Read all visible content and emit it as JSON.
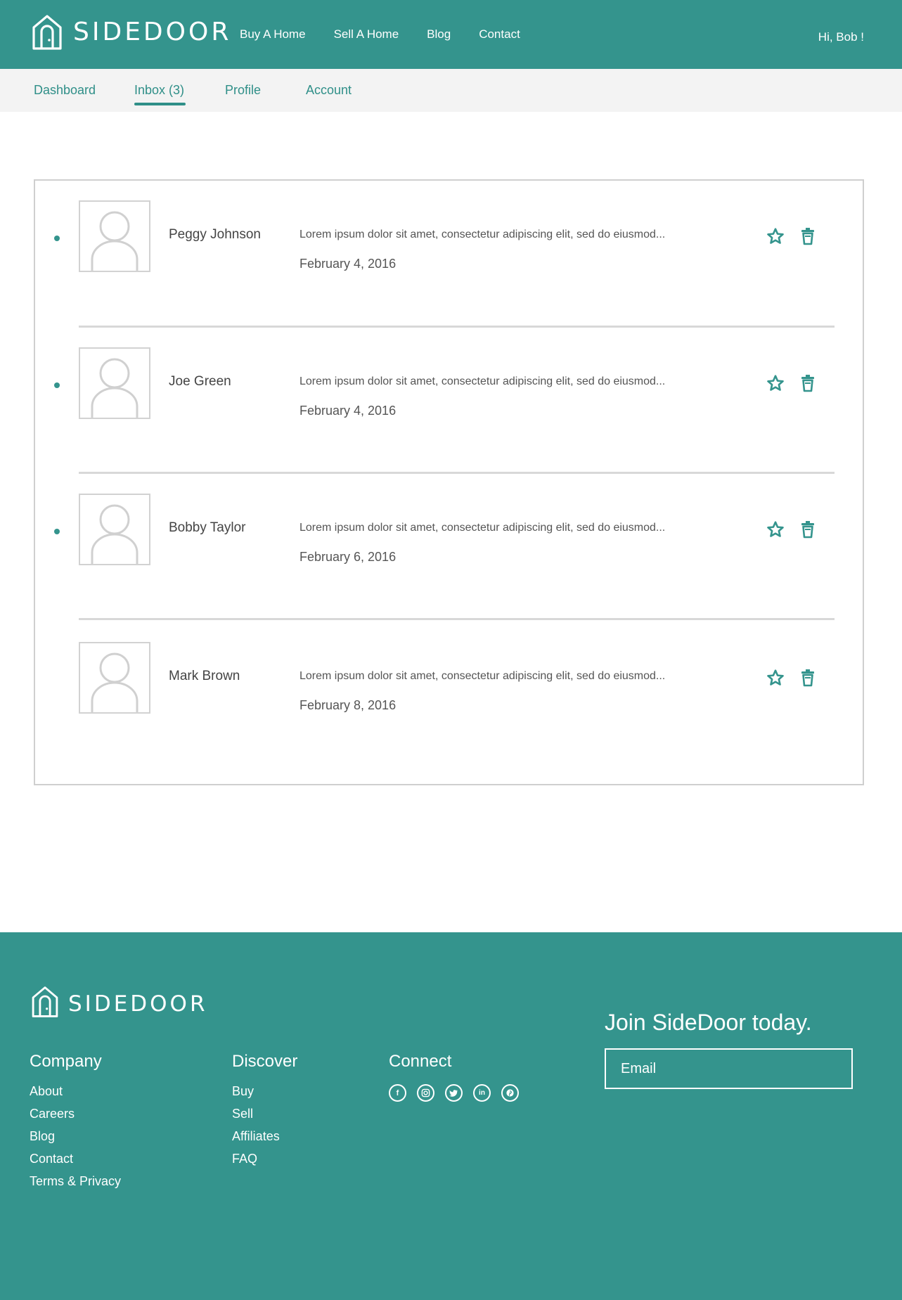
{
  "brand": {
    "name": "SIDEDOOR",
    "primary_color": "#34948d"
  },
  "header": {
    "nav": [
      "Buy A Home",
      "Sell A Home",
      "Blog",
      "Contact"
    ],
    "greeting": "Hi, Bob !"
  },
  "subnav": {
    "tabs": [
      "Dashboard",
      "Inbox (3)",
      "Profile",
      "Account"
    ],
    "active_tab": "Inbox (3)"
  },
  "inbox": {
    "messages": [
      {
        "sender": "Peggy Johnson",
        "preview": "Lorem ipsum dolor sit amet, consectetur adipiscing elit, sed do eiusmod...",
        "date": "February 4, 2016",
        "unread": true
      },
      {
        "sender": "Joe Green",
        "preview": "Lorem ipsum dolor sit amet, consectetur adipiscing elit, sed do eiusmod...",
        "date": "February 4, 2016",
        "unread": true
      },
      {
        "sender": "Bobby Taylor",
        "preview": "Lorem ipsum dolor sit amet, consectetur adipiscing elit, sed do eiusmod...",
        "date": "February 6, 2016",
        "unread": true
      },
      {
        "sender": "Mark Brown",
        "preview": "Lorem ipsum dolor sit amet, consectetur adipiscing elit, sed do eiusmod...",
        "date": "February 8, 2016",
        "unread": false
      }
    ],
    "icons": {
      "star": "star-icon",
      "delete": "trash-icon",
      "avatar": "user-placeholder-icon"
    }
  },
  "footer": {
    "brand": "SIDEDOOR",
    "company": {
      "title": "Company",
      "links": [
        "About",
        "Careers",
        "Blog",
        "Contact",
        "Terms & Privacy"
      ]
    },
    "discover": {
      "title": "Discover",
      "links": [
        "Buy",
        "Sell",
        "Affiliates",
        "FAQ"
      ]
    },
    "connect": {
      "title": "Connect",
      "icons": [
        "facebook-icon",
        "instagram-icon",
        "twitter-icon",
        "linkedin-icon",
        "pinterest-icon"
      ]
    },
    "join": {
      "title": "Join SideDoor today.",
      "email_placeholder": "Email"
    }
  }
}
